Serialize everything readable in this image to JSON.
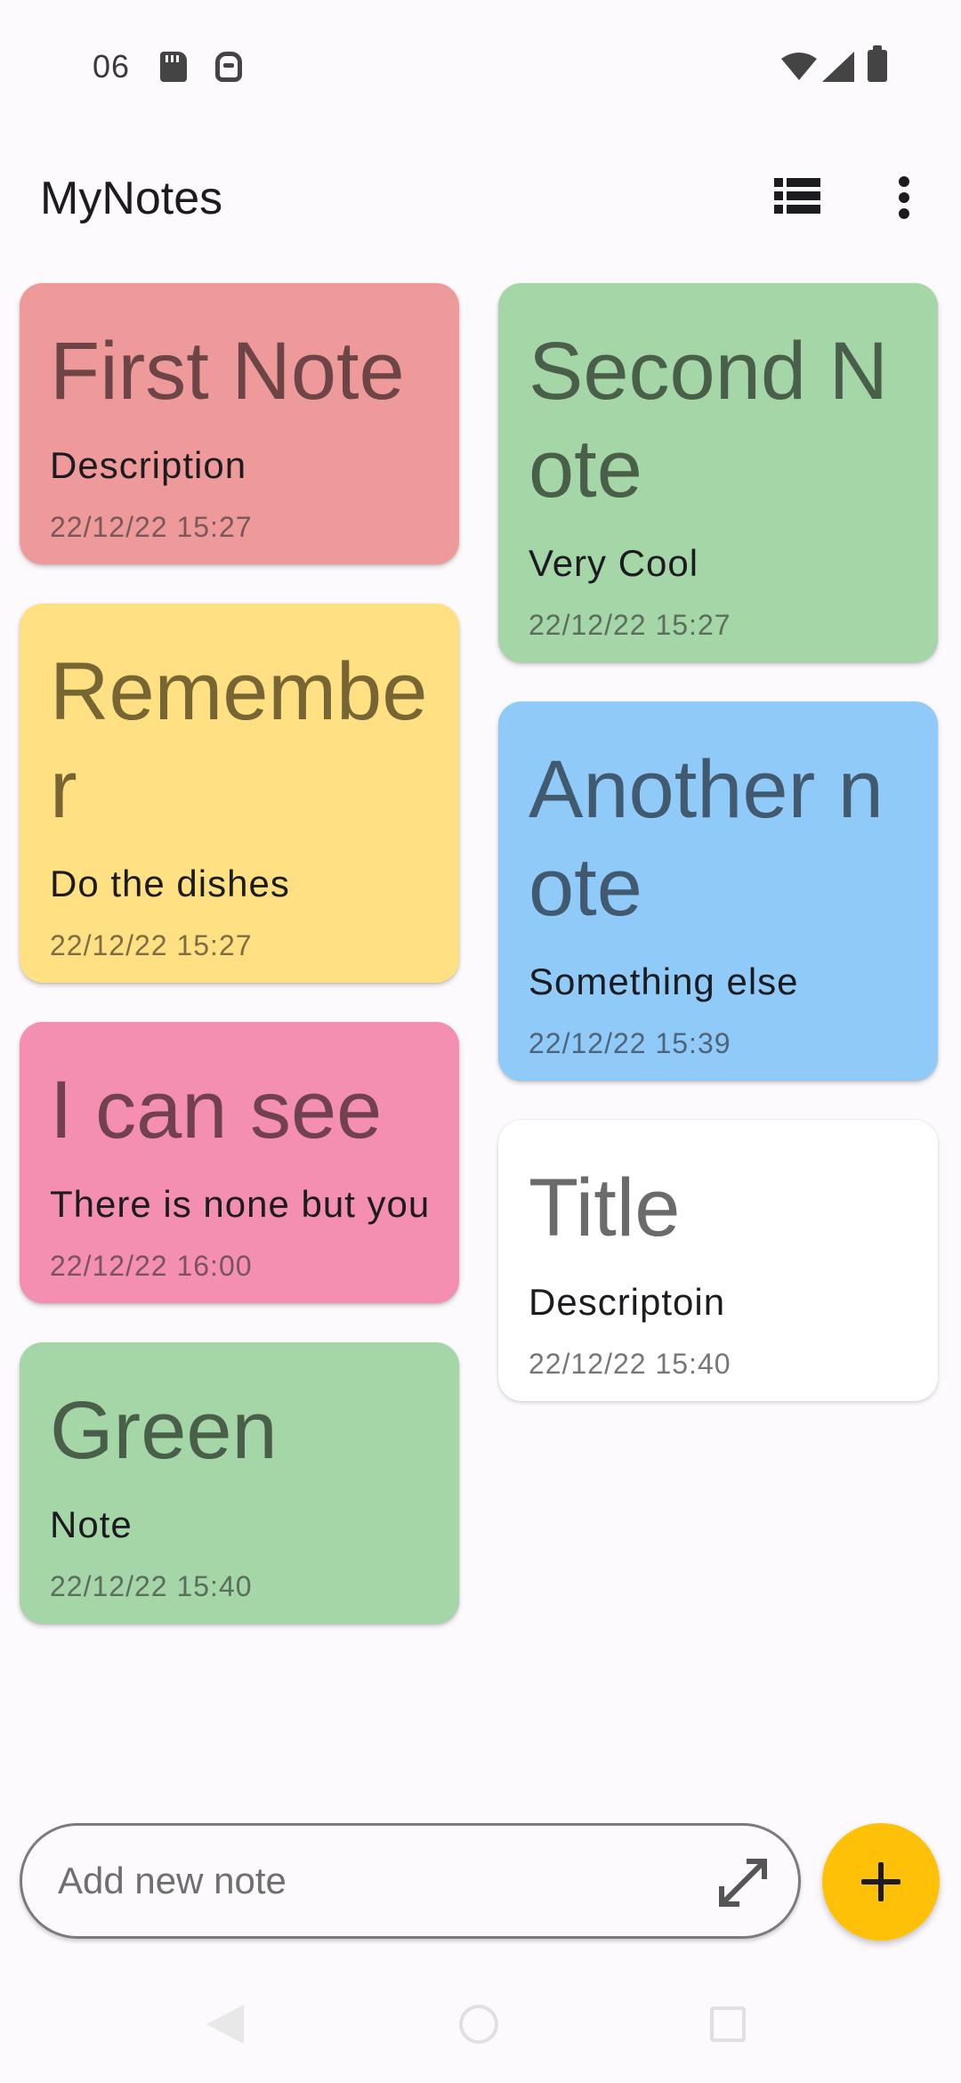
{
  "status_bar": {
    "time": "06",
    "icons": [
      "sd-card-icon",
      "robot-icon",
      "wifi-icon",
      "signal-icon",
      "battery-icon"
    ]
  },
  "app_bar": {
    "title": "MyNotes",
    "actions": [
      "list-view-icon",
      "more-vert-icon"
    ]
  },
  "notes_left": [
    {
      "title": "First Note",
      "description": "Description",
      "date": "22/12/22 15:27",
      "color": "#ef9a9a"
    },
    {
      "title": "Remember",
      "description": "Do the dishes",
      "date": "22/12/22 15:27",
      "color": "#ffe082"
    },
    {
      "title": "I can see",
      "description": "There is none but you",
      "date": "22/12/22 16:00",
      "color": "#f48fb1"
    },
    {
      "title": "Green",
      "description": "Note",
      "date": "22/12/22 15:40",
      "color": "#a5d6a7"
    }
  ],
  "notes_right": [
    {
      "title": "Second Note",
      "description": "Very Cool",
      "date": "22/12/22 15:27",
      "color": "#a5d6a7"
    },
    {
      "title": "Another note",
      "description": "Something else",
      "date": "22/12/22 15:39",
      "color": "#90caf9"
    },
    {
      "title": "Title",
      "description": "Descriptoin",
      "date": "22/12/22 15:40",
      "color": "#ffffff"
    }
  ],
  "add_note": {
    "placeholder": "Add new note",
    "value": "",
    "expand_icon": "expand-icon",
    "fab_icon": "add-icon",
    "fab_color": "#ffc107"
  },
  "nav_bar": [
    "back-icon",
    "home-icon",
    "recents-icon"
  ]
}
